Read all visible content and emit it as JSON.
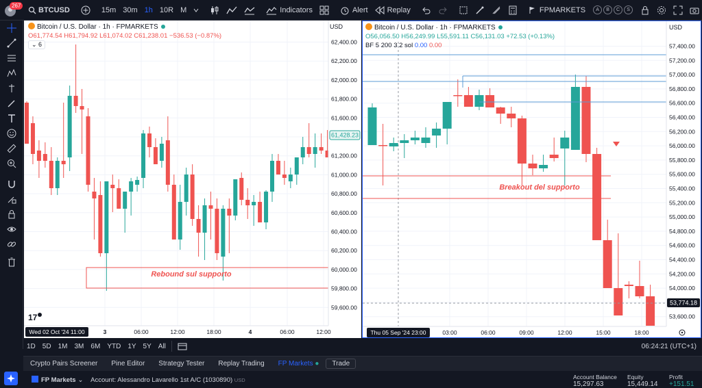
{
  "topbar": {
    "notif_count": "267",
    "symbol": "BTCUSD",
    "timeframes": [
      "15m",
      "30m",
      "1h",
      "10R",
      "M"
    ],
    "active_timeframe": "1h",
    "indicators_label": "Indicators",
    "alert_label": "Alert",
    "replay_label": "Replay",
    "broker_label": "FPMARKETS",
    "account_circles": [
      "A",
      "B",
      "C",
      "S"
    ]
  },
  "left_chart": {
    "title": "Bitcoin / U.S. Dollar · 1h · FPMARKETS",
    "ohlc": {
      "o": "O61,774.54",
      "h": "H61,794.92",
      "l": "L61,074.02",
      "c": "C61,238.01",
      "chg": "−536.53 (−0.87%)"
    },
    "indicator_count": "6",
    "currency": "USD",
    "price_label": "61,428.23",
    "annotation": "Rebound sul supporto",
    "y_ticks": [
      "62,400.00",
      "62,200.00",
      "62,000.00",
      "61,800.00",
      "61,600.00",
      "61,400.00",
      "61,200.00",
      "61,000.00",
      "60,800.00",
      "60,600.00",
      "60,400.00",
      "60,200.00",
      "60,000.00",
      "59,800.00",
      "59,600.00"
    ],
    "x_ticks": [
      "3",
      "06:00",
      "12:00",
      "18:00",
      "4",
      "06:00",
      "12:00"
    ],
    "cursor_date": "Wed 02 Oct '24   11:00"
  },
  "right_chart": {
    "title": "Bitcoin / U.S. Dollar · 1h · FPMARKETS",
    "ohlc": {
      "o": "O56,056.50",
      "h": "H56,249.99",
      "l": "L55,591.11",
      "c": "C56,131.03",
      "chg": "+72.53 (+0.13%)"
    },
    "indicator_line": {
      "name": "BF 5 200 3 2 sol",
      "v1": "0.00",
      "v2": "0.00"
    },
    "currency": "USD",
    "price_label": "53,774.18",
    "annotation": "Breakout del supporto",
    "y_ticks": [
      "57,400.00",
      "57,200.00",
      "57,000.00",
      "56,800.00",
      "56,600.00",
      "56,400.00",
      "56,200.00",
      "56,000.00",
      "55,800.00",
      "55,600.00",
      "55,400.00",
      "55,200.00",
      "55,000.00",
      "54,800.00",
      "54,600.00",
      "54,400.00",
      "54,200.00",
      "54,000.00",
      "53,800.00",
      "53,600.00"
    ],
    "x_ticks": [
      "03:00",
      "06:00",
      "09:00",
      "12:00",
      "15:00",
      "18:00"
    ],
    "cursor_date": "Thu 05 Sep '24   23:00"
  },
  "bottombar": {
    "ranges": [
      "1D",
      "5D",
      "1M",
      "3M",
      "6M",
      "YTD",
      "1Y",
      "5Y",
      "All"
    ],
    "clock": "06:24:21 (UTC+1)"
  },
  "tabs": [
    "Crypto Pairs Screener",
    "Pine Editor",
    "Strategy Tester",
    "Replay Trading",
    "FP Markets"
  ],
  "trade_label": "Trade",
  "account": {
    "broker": "FP Markets",
    "account_text": "Account: Alessandro Lavarello 1st A/C (1030890)",
    "account_currency": "USD",
    "balance_label": "Account Balance",
    "balance_value": "15,297.63",
    "equity_label": "Equity",
    "equity_value": "15,449.14",
    "profit_label": "Profit",
    "profit_value": "+151.51"
  },
  "colors": {
    "bull": "#26a69a",
    "bear": "#ef5350",
    "accent": "#2962ff",
    "bg": "#131722"
  }
}
